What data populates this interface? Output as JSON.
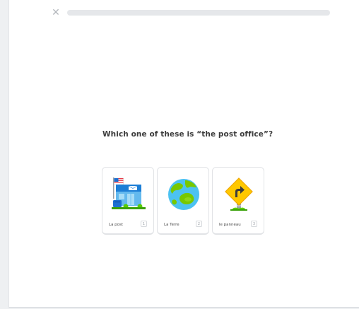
{
  "header": {
    "close_icon": "close-icon",
    "progress_fraction": 0
  },
  "question": "Which one of these is “the post office”?",
  "choices": [
    {
      "label": "La post",
      "key": "1",
      "icon": "post-office-icon"
    },
    {
      "label": "La Terre",
      "key": "2",
      "icon": "earth-globe-icon"
    },
    {
      "label": "le panneau",
      "key": "3",
      "icon": "road-sign-icon"
    }
  ],
  "colors": {
    "background": "#ffffff",
    "progress_track": "#e5e7ea",
    "card_border": "#e1e3e6",
    "text": "#3c3c3c"
  }
}
